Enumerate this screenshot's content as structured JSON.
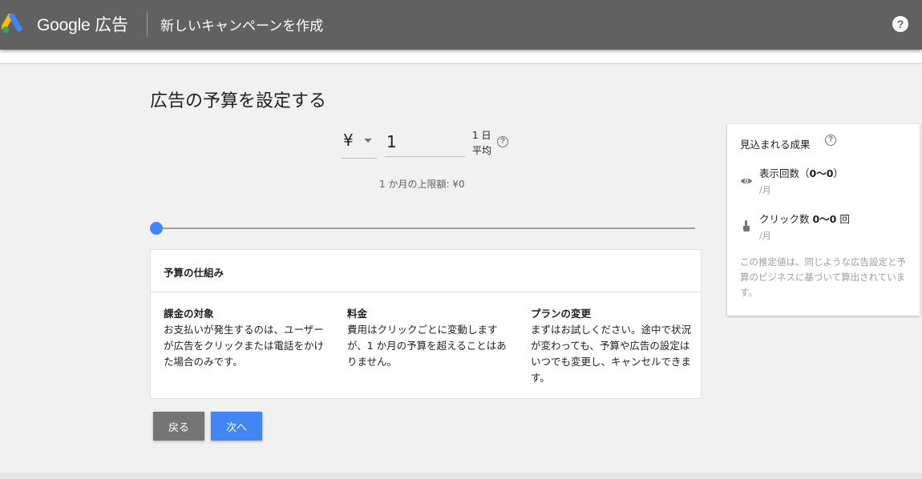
{
  "header": {
    "brand": "Google 広告",
    "title": "新しいキャンペーンを作成",
    "help_label": "?"
  },
  "main": {
    "page_title": "広告の予算を設定する",
    "currency_symbol": "¥",
    "amount_value": "1",
    "per_day_line1": "1 日",
    "per_day_line2": "平均",
    "help_label": "?",
    "monthly_limit": "1 か月の上限額: ¥0",
    "slider_level": 0
  },
  "info_card": {
    "title": "予算の仕組み",
    "columns": [
      {
        "title": "課金の対象",
        "body": "お支払いが発生するのは、ユーザーが広告をクリックまたは電話をかけた場合のみです。"
      },
      {
        "title": "料金",
        "body": "費用はクリックごとに変動しますが、1 か月の予算を超えることはありません。"
      },
      {
        "title": "プランの変更",
        "body": "まずはお試しください。途中で状況が変わっても、予算や広告の設定はいつでも変更し、キャンセルできます。"
      }
    ]
  },
  "buttons": {
    "back": "戻る",
    "next": "次へ"
  },
  "side_panel": {
    "title": "見込まれる成果",
    "help_label": "?",
    "impressions_prefix": "表示回数（",
    "impressions_value": "0〜0",
    "impressions_suffix": "）",
    "impressions_unit": "/月",
    "clicks_prefix": "クリック数 ",
    "clicks_value": "0〜0",
    "clicks_suffix": " 回",
    "clicks_unit": "/月",
    "note": "この推定値は、同じような広告設定と予算のビジネスに基づいて算出されています。"
  },
  "colors": {
    "header_bg": "#616161",
    "accent": "#4285f4",
    "back_button": "#757575",
    "page_bg": "#f1f1f1"
  },
  "icons": [
    "google-ads-logo",
    "help-icon",
    "dropdown-caret-icon",
    "eye-icon",
    "pointer-hand-icon"
  ]
}
